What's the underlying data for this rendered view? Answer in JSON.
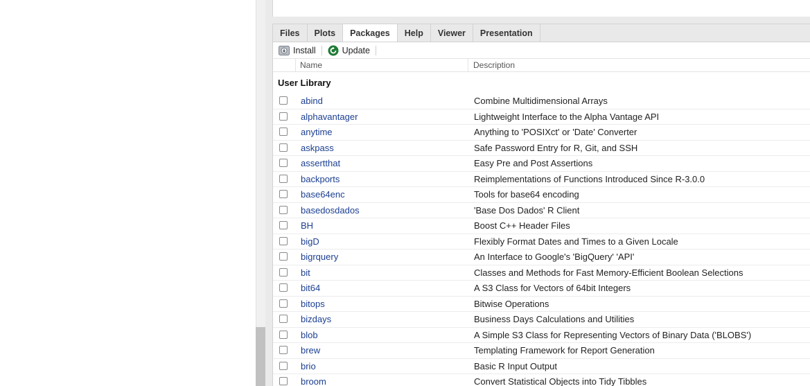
{
  "tabs": [
    {
      "label": "Files",
      "active": false
    },
    {
      "label": "Plots",
      "active": false
    },
    {
      "label": "Packages",
      "active": true
    },
    {
      "label": "Help",
      "active": false
    },
    {
      "label": "Viewer",
      "active": false
    },
    {
      "label": "Presentation",
      "active": false
    }
  ],
  "toolbar": {
    "install_label": "Install",
    "update_label": "Update"
  },
  "columns": {
    "name": "Name",
    "description": "Description"
  },
  "library_title": "User Library",
  "packages": [
    {
      "name": "abind",
      "description": "Combine Multidimensional Arrays"
    },
    {
      "name": "alphavantager",
      "description": "Lightweight Interface to the Alpha Vantage API"
    },
    {
      "name": "anytime",
      "description": "Anything to 'POSIXct' or 'Date' Converter"
    },
    {
      "name": "askpass",
      "description": "Safe Password Entry for R, Git, and SSH"
    },
    {
      "name": "assertthat",
      "description": "Easy Pre and Post Assertions"
    },
    {
      "name": "backports",
      "description": "Reimplementations of Functions Introduced Since R-3.0.0"
    },
    {
      "name": "base64enc",
      "description": "Tools for base64 encoding"
    },
    {
      "name": "basedosdados",
      "description": "'Base Dos Dados' R Client"
    },
    {
      "name": "BH",
      "description": "Boost C++ Header Files"
    },
    {
      "name": "bigD",
      "description": "Flexibly Format Dates and Times to a Given Locale"
    },
    {
      "name": "bigrquery",
      "description": "An Interface to Google's 'BigQuery' 'API'"
    },
    {
      "name": "bit",
      "description": "Classes and Methods for Fast Memory-Efficient Boolean Selections"
    },
    {
      "name": "bit64",
      "description": "A S3 Class for Vectors of 64bit Integers"
    },
    {
      "name": "bitops",
      "description": "Bitwise Operations"
    },
    {
      "name": "bizdays",
      "description": "Business Days Calculations and Utilities"
    },
    {
      "name": "blob",
      "description": "A Simple S3 Class for Representing Vectors of Binary Data ('BLOBS')"
    },
    {
      "name": "brew",
      "description": "Templating Framework for Report Generation"
    },
    {
      "name": "brio",
      "description": "Basic R Input Output"
    },
    {
      "name": "broom",
      "description": "Convert Statistical Objects into Tidy Tibbles"
    }
  ],
  "colors": {
    "link": "#1b3f91",
    "update_icon": "#1e7b34"
  }
}
